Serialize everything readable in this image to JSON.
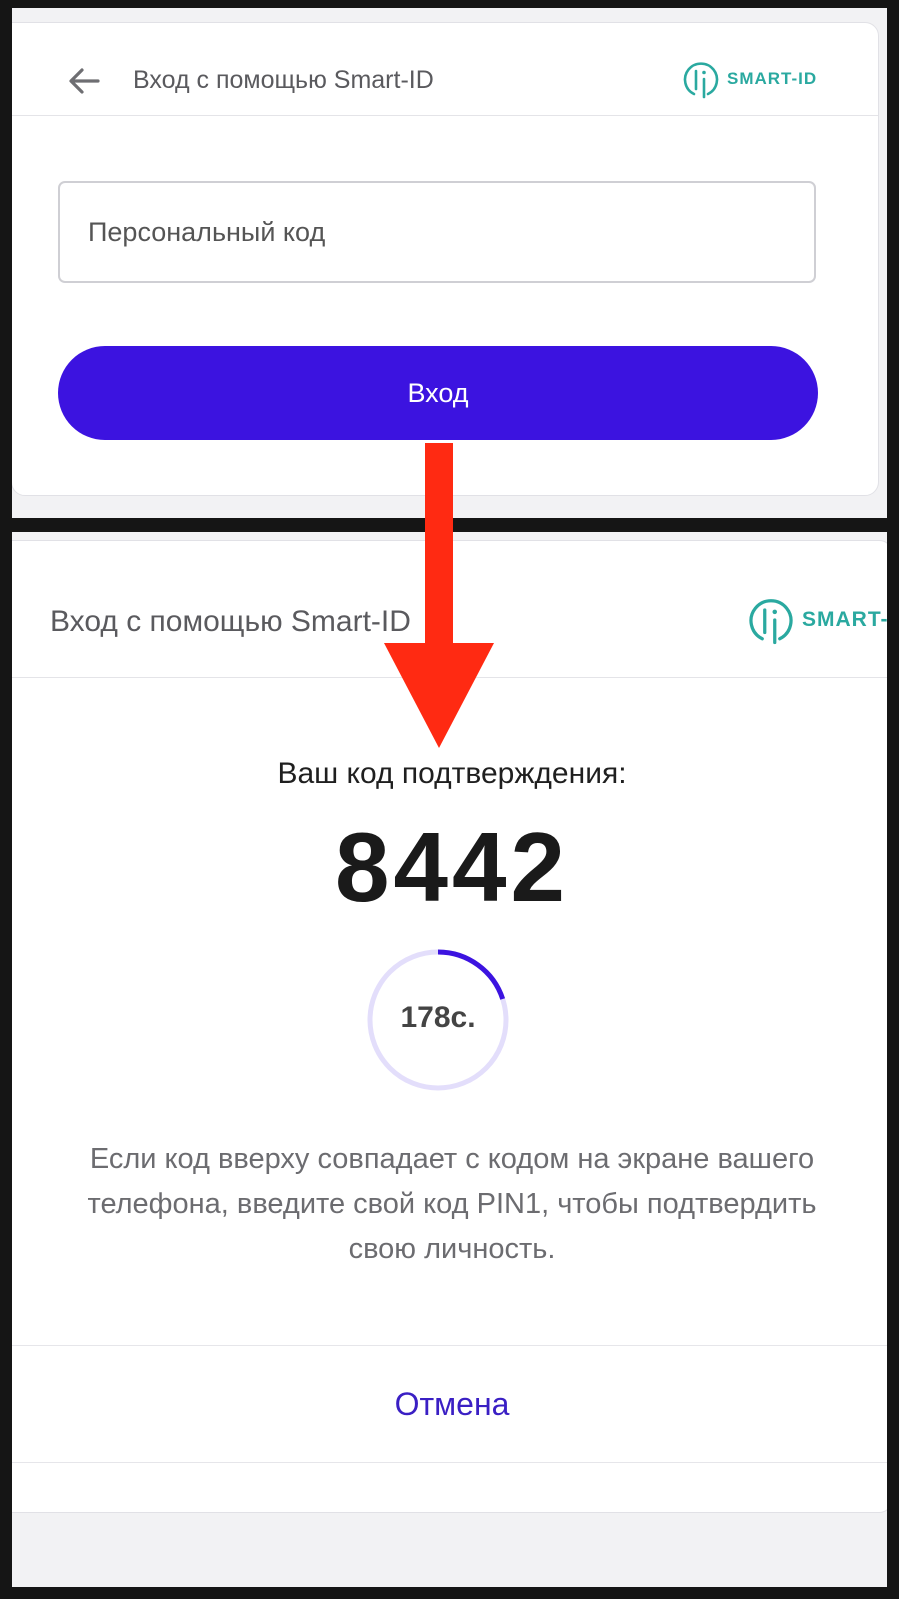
{
  "screen1": {
    "header": {
      "title": "Вход с помощью Smart-ID",
      "logo_text": "SMART-ID"
    },
    "personal_code_input": {
      "placeholder": "Персональный код",
      "value": ""
    },
    "login_button_label": "Вход"
  },
  "screen2": {
    "header": {
      "title": "Вход с помощью Smart-ID",
      "logo_text": "SMART-ID"
    },
    "verification_label": "Ваш код подтверждения:",
    "verification_code": "8442",
    "timer": {
      "remaining_text": "178с.",
      "progress_fraction": 0.2
    },
    "instruction": "Если код вверху совпадает с кодом на экране вашего телефона, введите свой код PIN1, чтобы подтвердить свою личность.",
    "cancel_label": "Отмена"
  },
  "colors": {
    "primary": "#3c13e0",
    "accent_teal": "#2aa9a0",
    "arrow_red": "#ff2a12",
    "timer_track": "#e3defb",
    "frame_background": "#151515"
  }
}
